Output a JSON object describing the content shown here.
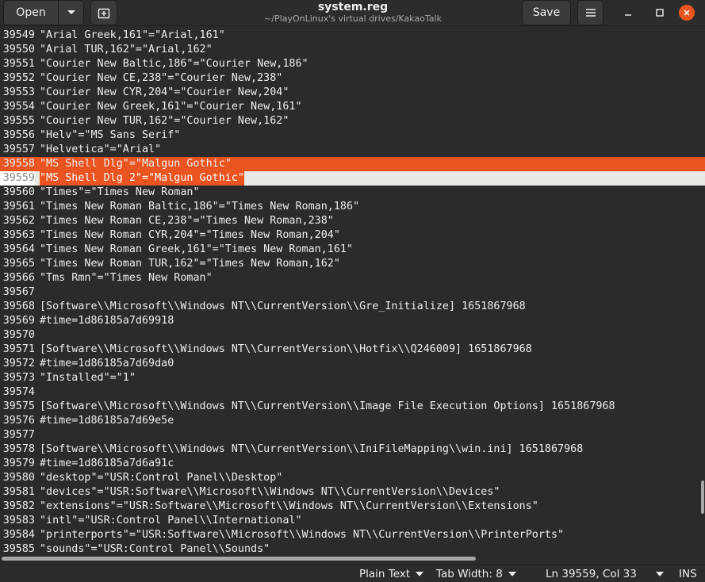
{
  "header": {
    "open_label": "Open",
    "save_label": "Save",
    "title": "system.reg",
    "subtitle": "~/PlayOnLinux's virtual drives/KakaoTalk"
  },
  "editor": {
    "lines": [
      {
        "n": "39549",
        "t": "\"Arial Greek,161\"=\"Arial,161\""
      },
      {
        "n": "39550",
        "t": "\"Arial TUR,162\"=\"Arial,162\""
      },
      {
        "n": "39551",
        "t": "\"Courier New Baltic,186\"=\"Courier New,186\""
      },
      {
        "n": "39552",
        "t": "\"Courier New CE,238\"=\"Courier New,238\""
      },
      {
        "n": "39553",
        "t": "\"Courier New CYR,204\"=\"Courier New,204\""
      },
      {
        "n": "39554",
        "t": "\"Courier New Greek,161\"=\"Courier New,161\""
      },
      {
        "n": "39555",
        "t": "\"Courier New TUR,162\"=\"Courier New,162\""
      },
      {
        "n": "39556",
        "t": "\"Helv\"=\"MS Sans Serif\""
      },
      {
        "n": "39557",
        "t": "\"Helvetica\"=\"Arial\""
      },
      {
        "n": "39558",
        "t": "\"MS Shell Dlg\"=\"Malgun Gothic\""
      },
      {
        "n": "39559",
        "t": "\"MS Shell Dlg 2\"=\"Malgun Gothic\""
      },
      {
        "n": "39560",
        "t": "\"Times\"=\"Times New Roman\""
      },
      {
        "n": "39561",
        "t": "\"Times New Roman Baltic,186\"=\"Times New Roman,186\""
      },
      {
        "n": "39562",
        "t": "\"Times New Roman CE,238\"=\"Times New Roman,238\""
      },
      {
        "n": "39563",
        "t": "\"Times New Roman CYR,204\"=\"Times New Roman,204\""
      },
      {
        "n": "39564",
        "t": "\"Times New Roman Greek,161\"=\"Times New Roman,161\""
      },
      {
        "n": "39565",
        "t": "\"Times New Roman TUR,162\"=\"Times New Roman,162\""
      },
      {
        "n": "39566",
        "t": "\"Tms Rmn\"=\"Times New Roman\""
      },
      {
        "n": "39567",
        "t": ""
      },
      {
        "n": "39568",
        "t": "[Software\\\\Microsoft\\\\Windows NT\\\\CurrentVersion\\\\Gre_Initialize] 1651867968"
      },
      {
        "n": "39569",
        "t": "#time=1d86185a7d69918"
      },
      {
        "n": "39570",
        "t": ""
      },
      {
        "n": "39571",
        "t": "[Software\\\\Microsoft\\\\Windows NT\\\\CurrentVersion\\\\Hotfix\\\\Q246009] 1651867968"
      },
      {
        "n": "39572",
        "t": "#time=1d86185a7d69da0"
      },
      {
        "n": "39573",
        "t": "\"Installed\"=\"1\""
      },
      {
        "n": "39574",
        "t": ""
      },
      {
        "n": "39575",
        "t": "[Software\\\\Microsoft\\\\Windows NT\\\\CurrentVersion\\\\Image File Execution Options] 1651867968"
      },
      {
        "n": "39576",
        "t": "#time=1d86185a7d69e5e"
      },
      {
        "n": "39577",
        "t": ""
      },
      {
        "n": "39578",
        "t": "[Software\\\\Microsoft\\\\Windows NT\\\\CurrentVersion\\\\IniFileMapping\\\\win.ini] 1651867968"
      },
      {
        "n": "39579",
        "t": "#time=1d86185a7d6a91c"
      },
      {
        "n": "39580",
        "t": "\"desktop\"=\"USR:Control Panel\\\\Desktop\""
      },
      {
        "n": "39581",
        "t": "\"devices\"=\"USR:Software\\\\Microsoft\\\\Windows NT\\\\CurrentVersion\\\\Devices\""
      },
      {
        "n": "39582",
        "t": "\"extensions\"=\"USR:Software\\\\Microsoft\\\\Windows NT\\\\CurrentVersion\\\\Extensions\""
      },
      {
        "n": "39583",
        "t": "\"intl\"=\"USR:Control Panel\\\\International\""
      },
      {
        "n": "39584",
        "t": "\"printerports\"=\"USR:Software\\\\Microsoft\\\\Windows NT\\\\CurrentVersion\\\\PrinterPorts\""
      },
      {
        "n": "39585",
        "t": "\"sounds\"=\"USR:Control Panel\\\\Sounds\""
      }
    ],
    "selected_lines": [
      "39558",
      "39559"
    ],
    "current_line": "39559"
  },
  "statusbar": {
    "language": "Plain Text",
    "tab_width": "Tab Width: 8",
    "position": "Ln 39559, Col 33",
    "mode": "INS"
  },
  "colors": {
    "accent": "#e95420",
    "background": "#2b2b2b",
    "text": "#eeeeec"
  }
}
